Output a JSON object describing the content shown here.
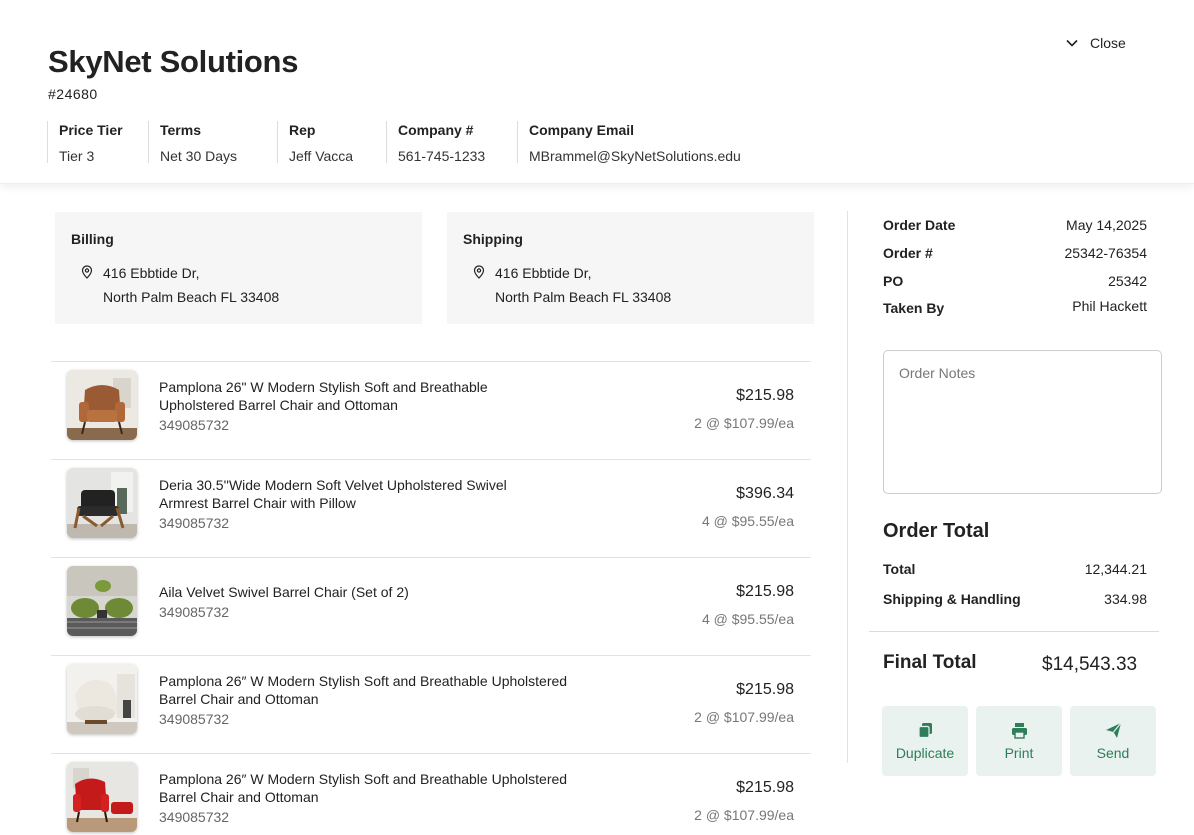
{
  "company": {
    "name": "SkyNet Solutions",
    "id": "#24680",
    "close_label": "Close"
  },
  "meta": [
    {
      "label": "Price Tier",
      "value": "Tier 3"
    },
    {
      "label": "Terms",
      "value": "Net 30 Days"
    },
    {
      "label": "Rep",
      "value": "Jeff Vacca"
    },
    {
      "label": "Company #",
      "value": "561-745-1233"
    },
    {
      "label": "Company Email",
      "value": "MBrammel@SkyNetSolutions.edu"
    }
  ],
  "billing": {
    "title": "Billing",
    "line1": "416 Ebbtide Dr,",
    "line2": "North Palm Beach FL 33408"
  },
  "shipping": {
    "title": "Shipping",
    "line1": "416 Ebbtide Dr,",
    "line2": "North Palm Beach FL 33408"
  },
  "items": [
    {
      "name1": "Pamplona 26\" W Modern Stylish Soft and Breathable",
      "name2": "Upholstered Barrel Chair and Ottoman",
      "sku": "349085732",
      "price": "$215.98",
      "qty": "2 @ $107.99/ea",
      "image": "brown-leather-chair"
    },
    {
      "name1": "Deria 30.5''Wide Modern Soft Velvet Upholstered Swivel",
      "name2": "Armrest Barrel Chair with Pillow",
      "sku": "349085732",
      "price": "$396.34",
      "qty": "4 @ $95.55/ea",
      "image": "black-wood-chair"
    },
    {
      "name1": "Aila Velvet Swivel Barrel Chair (Set of 2)",
      "name2": "",
      "sku": "349085732",
      "price": "$215.98",
      "qty": "4 @ $95.55/ea",
      "image": "green-chairs"
    },
    {
      "name1": "Pamplona 26″ W Modern Stylish Soft and Breathable Upholstered",
      "name2": "Barrel Chair and Ottoman",
      "sku": "349085732",
      "price": "$215.98",
      "qty": "2 @ $107.99/ea",
      "image": "white-boucle-chair"
    },
    {
      "name1": "Pamplona 26″ W Modern Stylish Soft and Breathable Upholstered",
      "name2": "Barrel Chair and Ottoman",
      "sku": "349085732",
      "price": "$215.98",
      "qty": "2 @ $107.99/ea",
      "image": "red-chair-ottoman"
    }
  ],
  "order": {
    "date_label": "Order Date",
    "date": "May 14,2025",
    "number_label": "Order #",
    "number": "25342-76354",
    "po_label": "PO",
    "po": "25342",
    "taken_label": "Taken By",
    "taken": "Phil Hackett",
    "notes_placeholder": "Order Notes"
  },
  "totals": {
    "title": "Order Total",
    "total_label": "Total",
    "total": "12,344.21",
    "shipping_label": "Shipping & Handling",
    "shipping": "334.98",
    "final_label": "Final Total",
    "final": "$14,543.33"
  },
  "actions": {
    "duplicate": "Duplicate",
    "print": "Print",
    "send": "Send"
  },
  "colors": {
    "accent": "#2e7d5b",
    "button_bg": "#e9f2ee",
    "card_bg": "#f6f6f6"
  }
}
